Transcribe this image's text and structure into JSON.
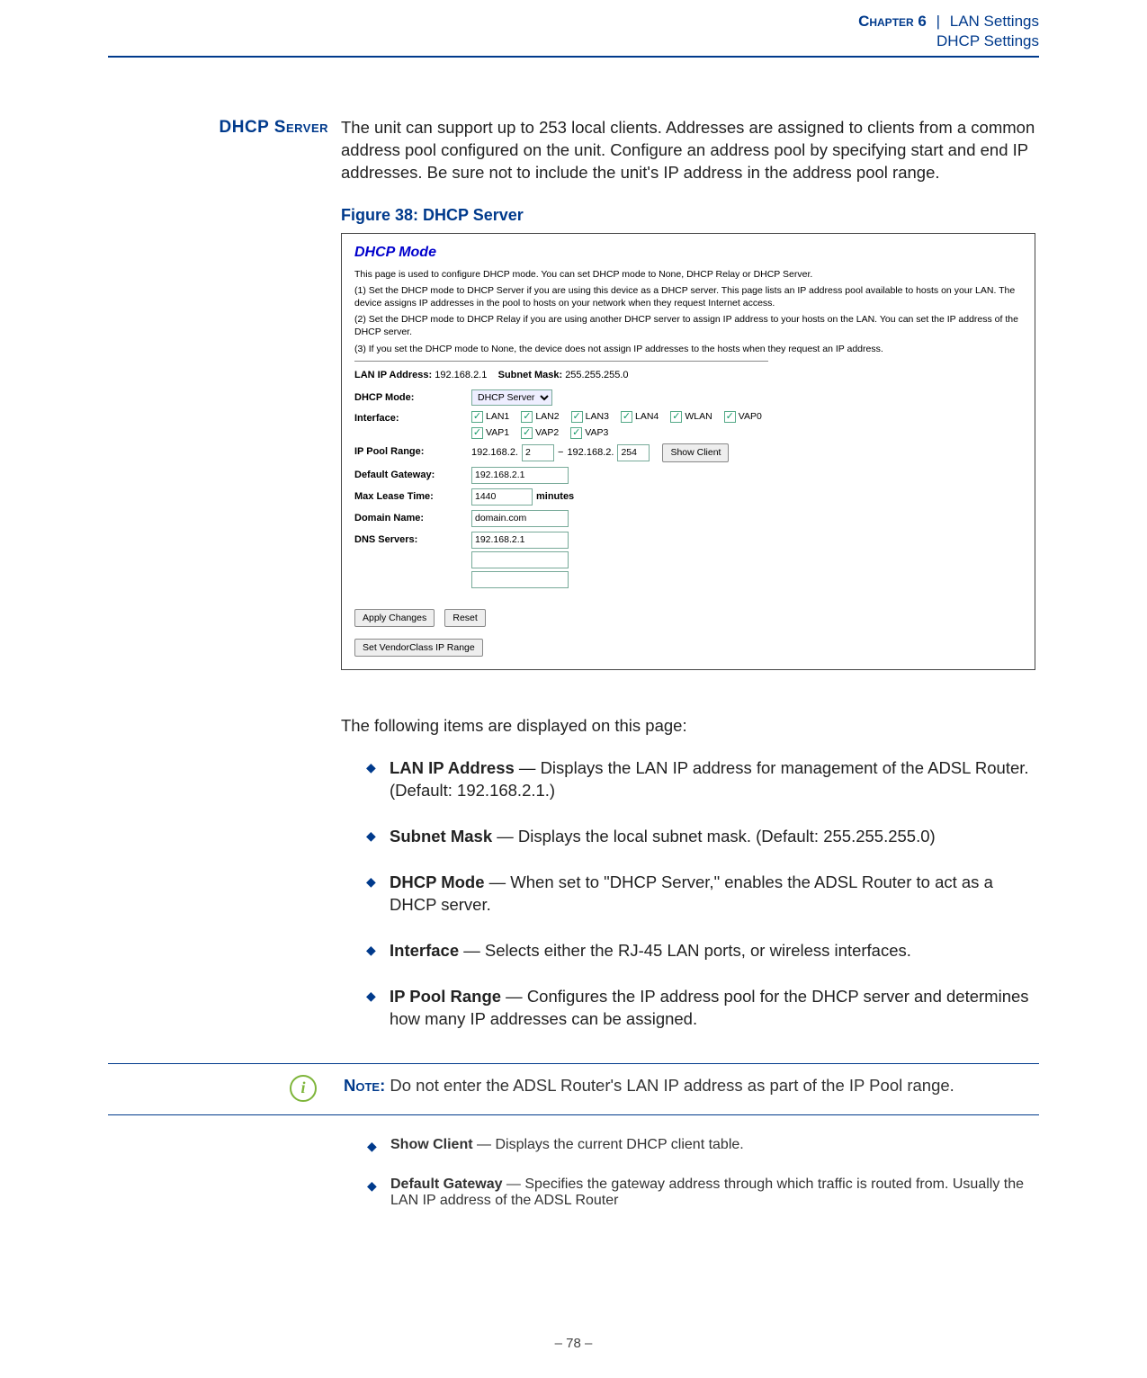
{
  "header": {
    "chapter_label": "Chapter 6",
    "separator": "|",
    "section": "LAN Settings",
    "subsection": "DHCP Settings"
  },
  "side_heading": "DHCP Server",
  "intro_paragraph": "The unit can support up to 253 local clients. Addresses are assigned to clients from a common address pool configured on the unit. Configure an address pool by specifying start and end IP addresses. Be sure not to include the unit's IP address in the address pool range.",
  "figure": {
    "caption": "Figure 38:  DHCP Server",
    "title": "DHCP Mode",
    "desc_intro": "This page is used to configure DHCP mode. You can set DHCP mode to None, DHCP Relay or DHCP Server.",
    "desc_1": "(1) Set the DHCP mode to DHCP Server if you are using this device as a DHCP server. This page lists an IP address pool available to hosts on your LAN. The device assigns IP addresses in the pool to hosts on your network when they request Internet access.",
    "desc_2": "(2) Set the DHCP mode to DHCP Relay if you are using another DHCP server to assign IP address to your hosts on the LAN. You can set the IP address of the DHCP server.",
    "desc_3": "(3) If you set the DHCP mode to None, the device does not assign IP addresses to the hosts when they request an IP address.",
    "lan_ip_label": "LAN IP Address:",
    "lan_ip_value": "192.168.2.1",
    "subnet_label": "Subnet Mask:",
    "subnet_value": "255.255.255.0",
    "rows": {
      "dhcp_mode_label": "DHCP Mode:",
      "dhcp_mode_value": "DHCP Server",
      "interface_label": "Interface:",
      "interfaces1": [
        "LAN1",
        "LAN2",
        "LAN3",
        "LAN4",
        "WLAN",
        "VAP0"
      ],
      "interfaces2": [
        "VAP1",
        "VAP2",
        "VAP3"
      ],
      "ip_pool_label": "IP Pool Range:",
      "ip_pool_prefix1": "192.168.2.",
      "ip_pool_start": "2",
      "ip_pool_dash": "−",
      "ip_pool_prefix2": "192.168.2.",
      "ip_pool_end": "254",
      "show_client_btn": "Show Client",
      "default_gw_label": "Default Gateway:",
      "default_gw_value": "192.168.2.1",
      "max_lease_label": "Max Lease Time:",
      "max_lease_value": "1440",
      "max_lease_unit": "minutes",
      "domain_label": "Domain Name:",
      "domain_value": "domain.com",
      "dns_label": "DNS Servers:",
      "dns1": "192.168.2.1",
      "dns2": "",
      "dns3": ""
    },
    "buttons": {
      "apply": "Apply Changes",
      "reset": "Reset",
      "vendor": "Set VendorClass IP Range"
    }
  },
  "after_figure_lead": "The following items are displayed on this page:",
  "bullets1": [
    {
      "lead": "LAN IP Address",
      "rest": " — Displays the LAN IP address for management of the ADSL Router. (Default: 192.168.2.1.)"
    },
    {
      "lead": "Subnet Mask",
      "rest": " — Displays the local subnet mask. (Default: 255.255.255.0)"
    },
    {
      "lead": "DHCP Mode",
      "rest": " — When set to \"DHCP Server,\" enables the ADSL Router to act as a DHCP server."
    },
    {
      "lead": "Interface",
      "rest": " — Selects either the RJ-45 LAN ports, or wireless interfaces."
    },
    {
      "lead": "IP Pool Range",
      "rest": " — Configures the IP address pool for the DHCP server and determines how many IP addresses can be assigned."
    }
  ],
  "note": {
    "icon_letter": "i",
    "lead": "Note:",
    "text": " Do not enter the ADSL Router's LAN IP address as part of the IP Pool range."
  },
  "bullets2": [
    {
      "lead": "Show Client",
      "rest": " — Displays the current DHCP client table."
    },
    {
      "lead": "Default Gateway",
      "rest": " — Specifies the gateway address through which traffic is routed from. Usually the LAN IP address of the ADSL Router"
    }
  ],
  "page_number": "–  78  –"
}
